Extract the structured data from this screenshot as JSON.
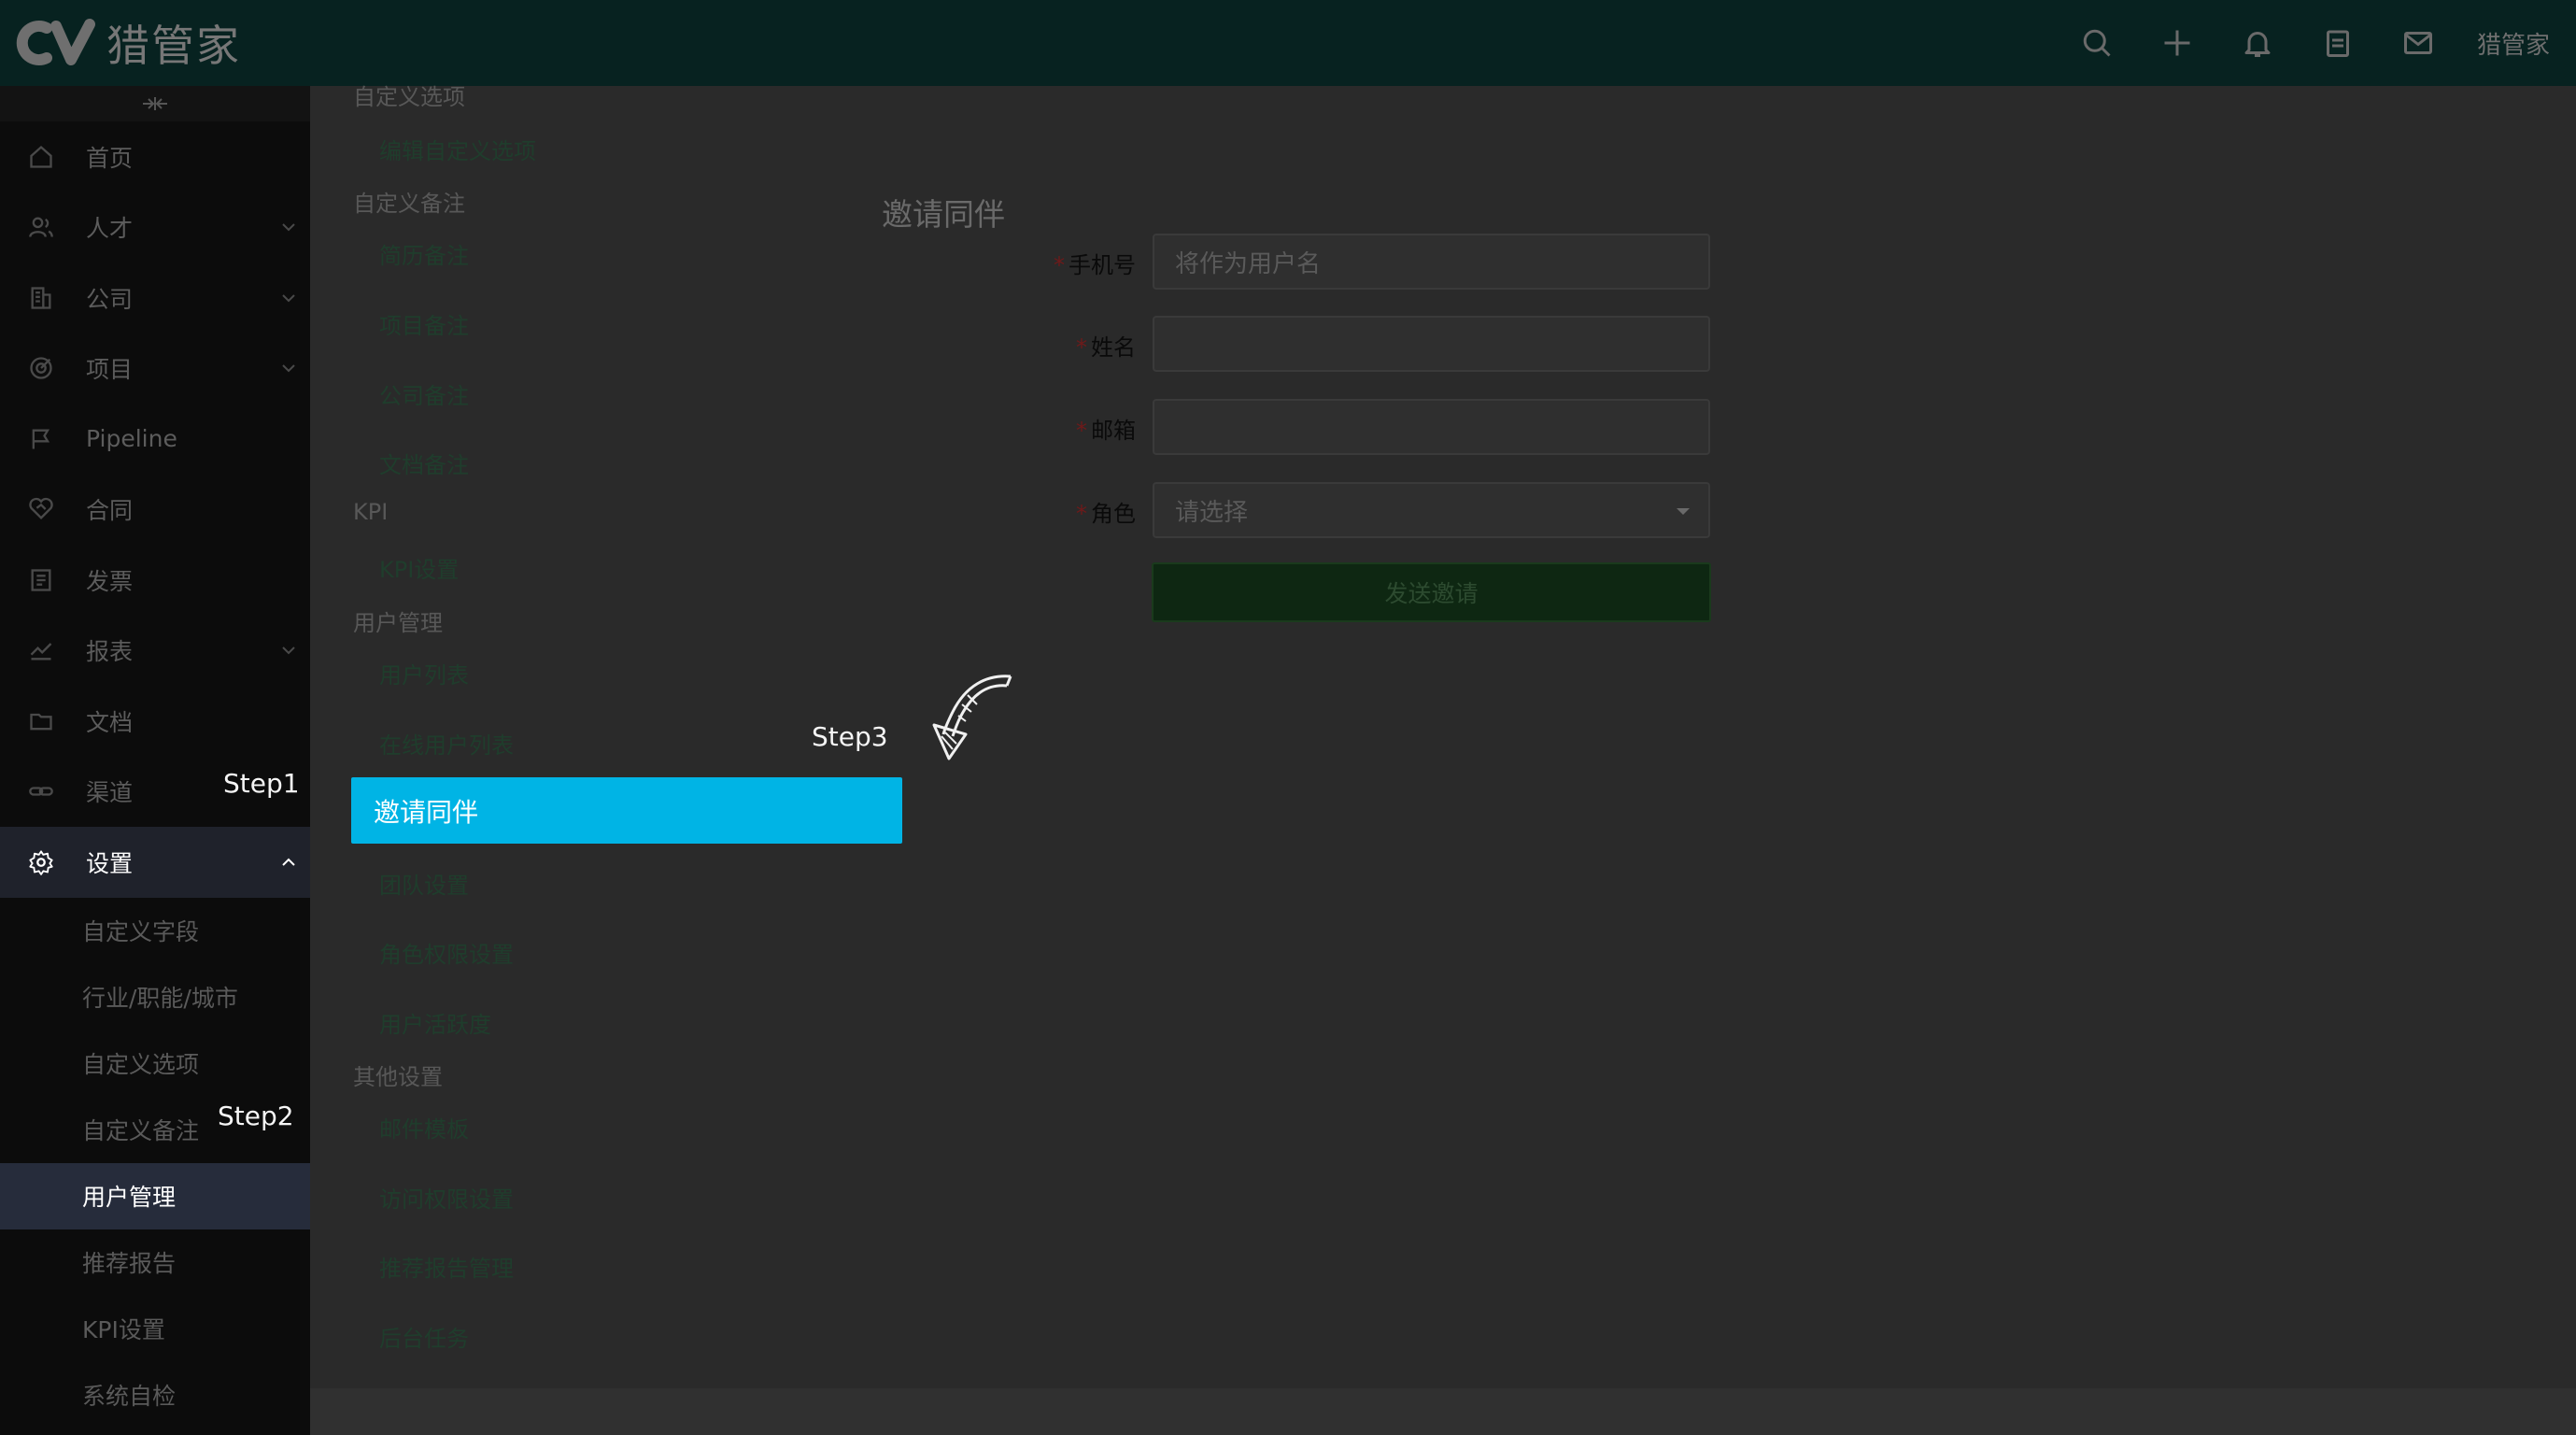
{
  "app": {
    "logo_text": "猎管家",
    "user_name": "猎管家"
  },
  "header_icons": [
    "search-icon",
    "plus-icon",
    "bell-icon",
    "clipboard-icon",
    "mail-icon"
  ],
  "sidebar": {
    "items": [
      {
        "label": "首页",
        "icon": "home-icon"
      },
      {
        "label": "人才",
        "icon": "users-icon",
        "expandable": true
      },
      {
        "label": "公司",
        "icon": "building-icon",
        "expandable": true
      },
      {
        "label": "项目",
        "icon": "target-icon",
        "expandable": true
      },
      {
        "label": "Pipeline",
        "icon": "flag-icon"
      },
      {
        "label": "合同",
        "icon": "handshake-icon"
      },
      {
        "label": "发票",
        "icon": "receipt-icon"
      },
      {
        "label": "报表",
        "icon": "trend-icon",
        "expandable": true
      },
      {
        "label": "文档",
        "icon": "folder-icon"
      },
      {
        "label": "渠道",
        "icon": "link-icon"
      },
      {
        "label": "设置",
        "icon": "gear-icon",
        "expanded": true,
        "active": true
      }
    ],
    "sub_items": [
      "自定义字段",
      "行业/职能/城市",
      "自定义选项",
      "自定义备注",
      "用户管理",
      "推荐报告",
      "KPI设置",
      "系统自检"
    ],
    "active_sub": "用户管理"
  },
  "settings_menu": {
    "top_partial": "自定义选项",
    "groups": [
      {
        "title": "",
        "links": [
          "编辑自定义选项"
        ]
      },
      {
        "title": "自定义备注",
        "links": [
          "简历备注",
          "项目备注",
          "公司备注",
          "文档备注"
        ]
      },
      {
        "title": "KPI",
        "links": [
          "KPI设置"
        ]
      },
      {
        "title": "用户管理",
        "links": [
          "用户列表",
          "在线用户列表",
          "邀请同伴",
          "团队设置",
          "角色权限设置",
          "用户活跃度"
        ]
      },
      {
        "title": "其他设置",
        "links": [
          "邮件模板",
          "访问权限设置",
          "推荐报告管理",
          "后台任务"
        ]
      }
    ],
    "selected": "邀请同伴"
  },
  "form": {
    "title": "邀请同伴",
    "fields": [
      {
        "label": "手机号",
        "required": true,
        "value": "",
        "placeholder": "将作为用户名"
      },
      {
        "label": "姓名",
        "required": true,
        "value": "",
        "placeholder": ""
      },
      {
        "label": "邮箱",
        "required": true,
        "value": "",
        "placeholder": ""
      },
      {
        "label": "角色",
        "required": true,
        "value": "请选择",
        "type": "select"
      }
    ],
    "submit_label": "发送邀请"
  },
  "annotations": {
    "step1": "Step1",
    "step2": "Step2",
    "step3": "Step3"
  },
  "colors": {
    "highlight": "#00b4e5",
    "topbar": "#072220",
    "sidebar": "#0c0c0c",
    "submit": "#0e2712"
  }
}
